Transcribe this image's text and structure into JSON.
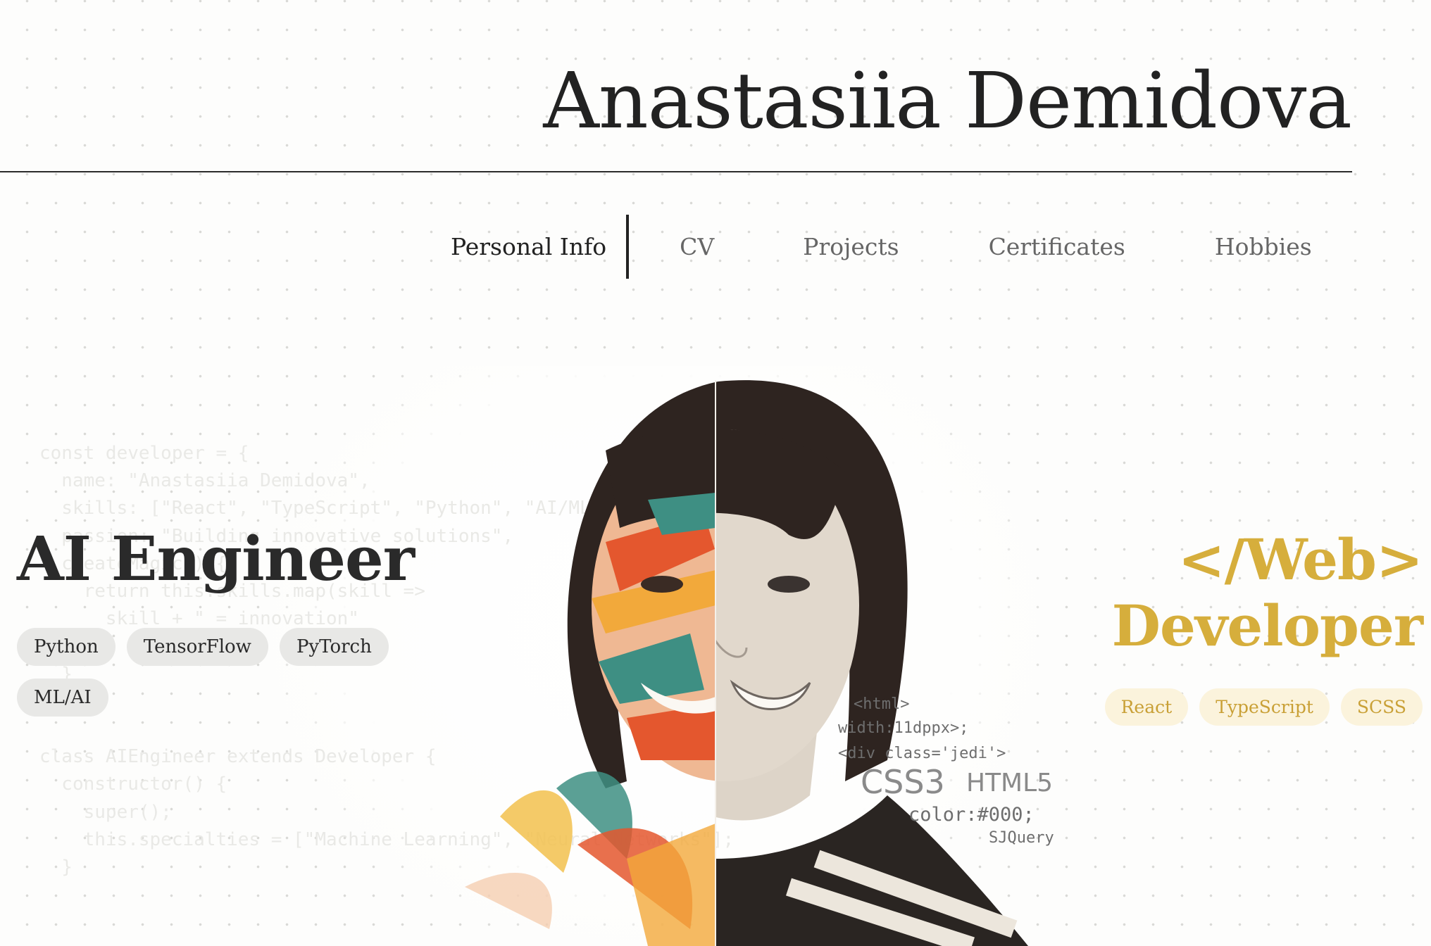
{
  "header": {
    "title": "Anastasiia Demidova"
  },
  "nav": {
    "items": [
      {
        "label": "Personal Info",
        "active": true
      },
      {
        "label": "CV"
      },
      {
        "label": "Projects"
      },
      {
        "label": "Certificates"
      },
      {
        "label": "Hobbies"
      }
    ]
  },
  "hero": {
    "left_role": "AI Engineer",
    "left_tags": [
      "Python",
      "TensorFlow",
      "PyTorch",
      "ML/AI"
    ],
    "right_role_line1": "</Web>",
    "right_role_line2": "Developer",
    "right_tags": [
      "React",
      "TypeScript",
      "SCSS"
    ],
    "background_code": "const developer = {\n  name: \"Anastasiia Demidova\",\n  skills: [\"React\", \"TypeScript\", \"Python\", \"AI/ML\"],\n  passion: \"Building innovative solutions\",\n  createMagic() {\n    return this.skills.map(skill =>\n      skill + \" = innovation\"\n    );\n  }\n};\n\nclass AIEngineer extends Developer {\n  constructor() {\n    super();\n    this.specialties = [\"Machine Learning\", \"Neural Networks\"];\n  }",
    "code_overlay": {
      "line1": "<html>",
      "line2": "width:11dppx>;",
      "line3": "<div class='jedi'>",
      "css3": "CSS3",
      "html5": "HTML5",
      "color": "color:#000;",
      "jquery": "SJQuery"
    }
  },
  "colors": {
    "accent_gold": "#d6ae3c",
    "tag_gray": "#e8e8e6",
    "tag_gold_bg": "#fbf3dc",
    "text_dark": "#2a2a2a"
  },
  "icons": [
    "portrait-illustration"
  ]
}
